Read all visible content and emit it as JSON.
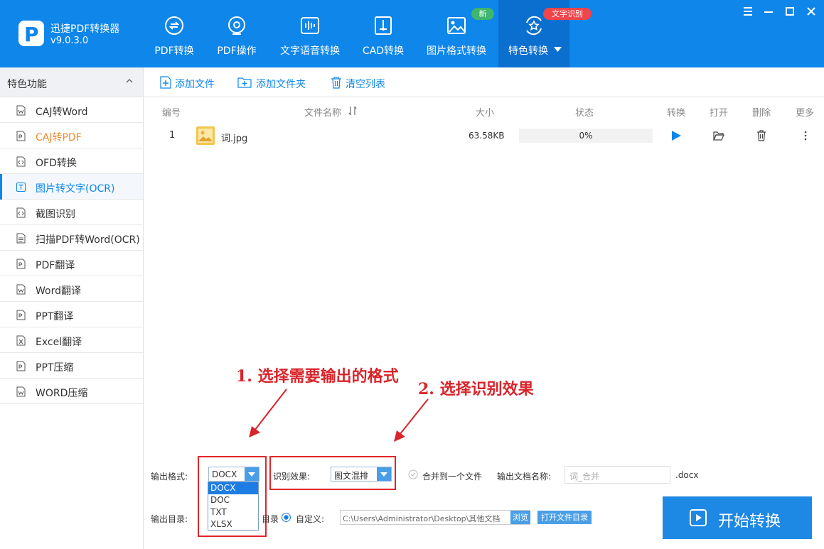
{
  "app": {
    "name": "迅捷PDF转换器",
    "version": "v9.0.3.0"
  },
  "nav": [
    {
      "label": "PDF转换",
      "icon": "pdf-convert-icon"
    },
    {
      "label": "PDF操作",
      "icon": "pdf-operate-icon"
    },
    {
      "label": "文字语音转换",
      "icon": "voice-wave-icon"
    },
    {
      "label": "CAD转换",
      "icon": "cad-icon"
    },
    {
      "label": "图片格式转换",
      "icon": "image-icon"
    },
    {
      "label": "特色转换",
      "icon": "star-convert-icon",
      "active": true
    }
  ],
  "badges": {
    "new": "新",
    "ocr": "文字识别"
  },
  "colors": {
    "brand": "#0f86ea",
    "badge_new": "#3fb56d",
    "badge_ocr": "#f0454a",
    "annotation": "#d9242a",
    "highlight": "#f08a2c"
  },
  "sidebar": {
    "title": "特色功能",
    "items": [
      {
        "label": "CAJ转Word"
      },
      {
        "label": "CAJ转PDF"
      },
      {
        "label": "OFD转换"
      },
      {
        "label": "图片转文字(OCR)"
      },
      {
        "label": "截图识别"
      },
      {
        "label": "扫描PDF转Word(OCR)"
      },
      {
        "label": "PDF翻译"
      },
      {
        "label": "Word翻译"
      },
      {
        "label": "PPT翻译"
      },
      {
        "label": "Excel翻译"
      },
      {
        "label": "PPT压缩"
      },
      {
        "label": "WORD压缩"
      }
    ]
  },
  "toolbar": {
    "add_file": "添加文件",
    "add_folder": "添加文件夹",
    "clear_list": "清空列表"
  },
  "table": {
    "headers": {
      "no": "编号",
      "name": "文件名称",
      "size": "大小",
      "status": "状态",
      "convert": "转换",
      "open": "打开",
      "delete": "删除",
      "more": "更多"
    },
    "rows": [
      {
        "no": "1",
        "name": "词.jpg",
        "size": "63.58KB",
        "progress": "0%",
        "progress_value": 0
      }
    ]
  },
  "output": {
    "format_label": "输出格式:",
    "format_selected": "DOCX",
    "format_options": [
      "DOCX",
      "DOC",
      "TXT",
      "XLSX"
    ],
    "effect_label": "识别效果:",
    "effect_selected": "图文混排",
    "merge_label": "合并到一个文件",
    "docname_label": "输出文档名称:",
    "docname_value": "词_合并",
    "docname_ext": ".docx",
    "dir_label": "输出目录:",
    "dir_partial": "目录",
    "custom_label": "自定义:",
    "dir_path": "C:\\Users\\Administrator\\Desktop\\其他文档",
    "browse": "浏览",
    "open_dir": "打开文件目录",
    "start": "开始转换"
  },
  "annotations": {
    "step1": "1. 选择需要输出的格式",
    "step2": "2. 选择识别效果"
  }
}
